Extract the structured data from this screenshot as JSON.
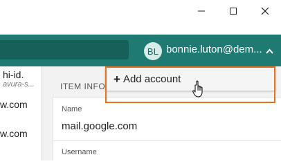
{
  "window": {
    "minimize_icon": "minimize-icon",
    "maximize_icon": "maximize-icon",
    "close_icon": "close-icon"
  },
  "header": {
    "avatar_initials": "BL",
    "user_email": "bonnie.luton@dem...",
    "chevron_icon": "chevron-up-icon",
    "accent_color": "#1f7a73"
  },
  "list": {
    "items": [
      {
        "title": "hi-id.",
        "subtitle": "avura-s..."
      },
      {
        "title": "w.com",
        "subtitle": ""
      },
      {
        "title": "w.com",
        "subtitle": ""
      }
    ]
  },
  "main": {
    "section_label": "ITEM INFO",
    "name_label": "Name",
    "name_value": "mail.google.com",
    "username_label": "Username"
  },
  "dropdown": {
    "add_account_label": "Add account",
    "plus_icon": "plus-icon"
  },
  "highlight_color": "#e8711f"
}
